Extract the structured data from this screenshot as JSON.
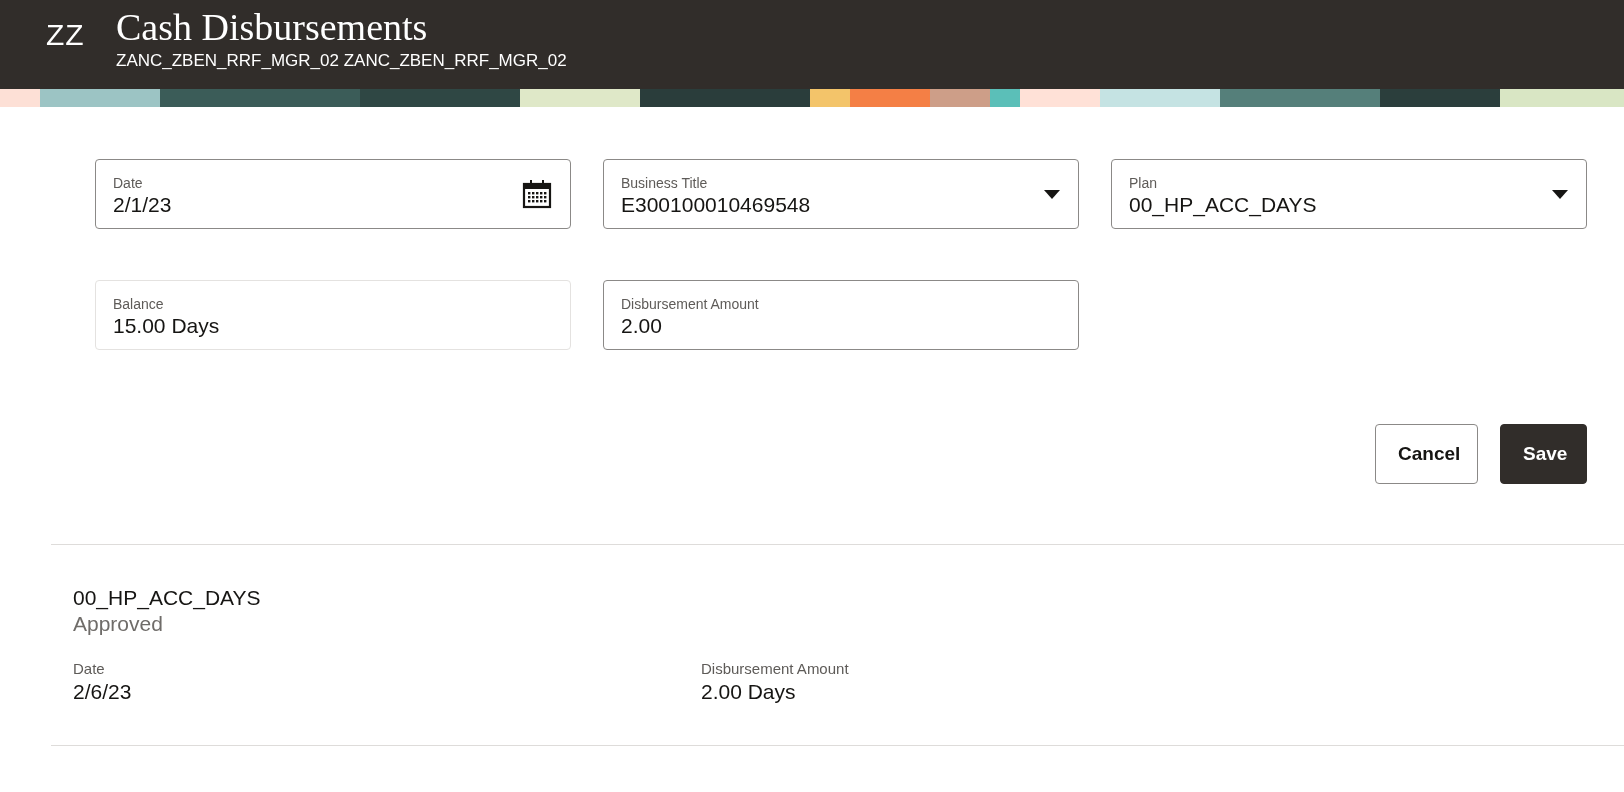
{
  "header": {
    "initials": "ZZ",
    "title": "Cash Disbursements",
    "subtitle": "ZANC_ZBEN_RRF_MGR_02 ZANC_ZBEN_RRF_MGR_02"
  },
  "form": {
    "fields": [
      {
        "kind": "date",
        "label": "Date",
        "value": "2/1/23",
        "readonly": false
      },
      {
        "kind": "select",
        "label": "Business Title",
        "value": "E300100010469548",
        "readonly": false
      },
      {
        "kind": "select",
        "label": "Plan",
        "value": "00_HP_ACC_DAYS",
        "readonly": false
      },
      {
        "kind": "text",
        "label": "Balance",
        "value": "15.00 Days",
        "readonly": true
      },
      {
        "kind": "text",
        "label": "Disbursement Amount",
        "value": "2.00",
        "readonly": false
      }
    ],
    "buttons": [
      {
        "label": "Cancel",
        "kind": "secondary"
      },
      {
        "label": "Save",
        "kind": "primary"
      }
    ]
  },
  "records": [
    {
      "title": "00_HP_ACC_DAYS",
      "status": "Approved",
      "details": [
        {
          "label": "Date",
          "value": "2/6/23"
        },
        {
          "label": "Disbursement Amount",
          "value": "2.00 Days"
        }
      ]
    }
  ]
}
